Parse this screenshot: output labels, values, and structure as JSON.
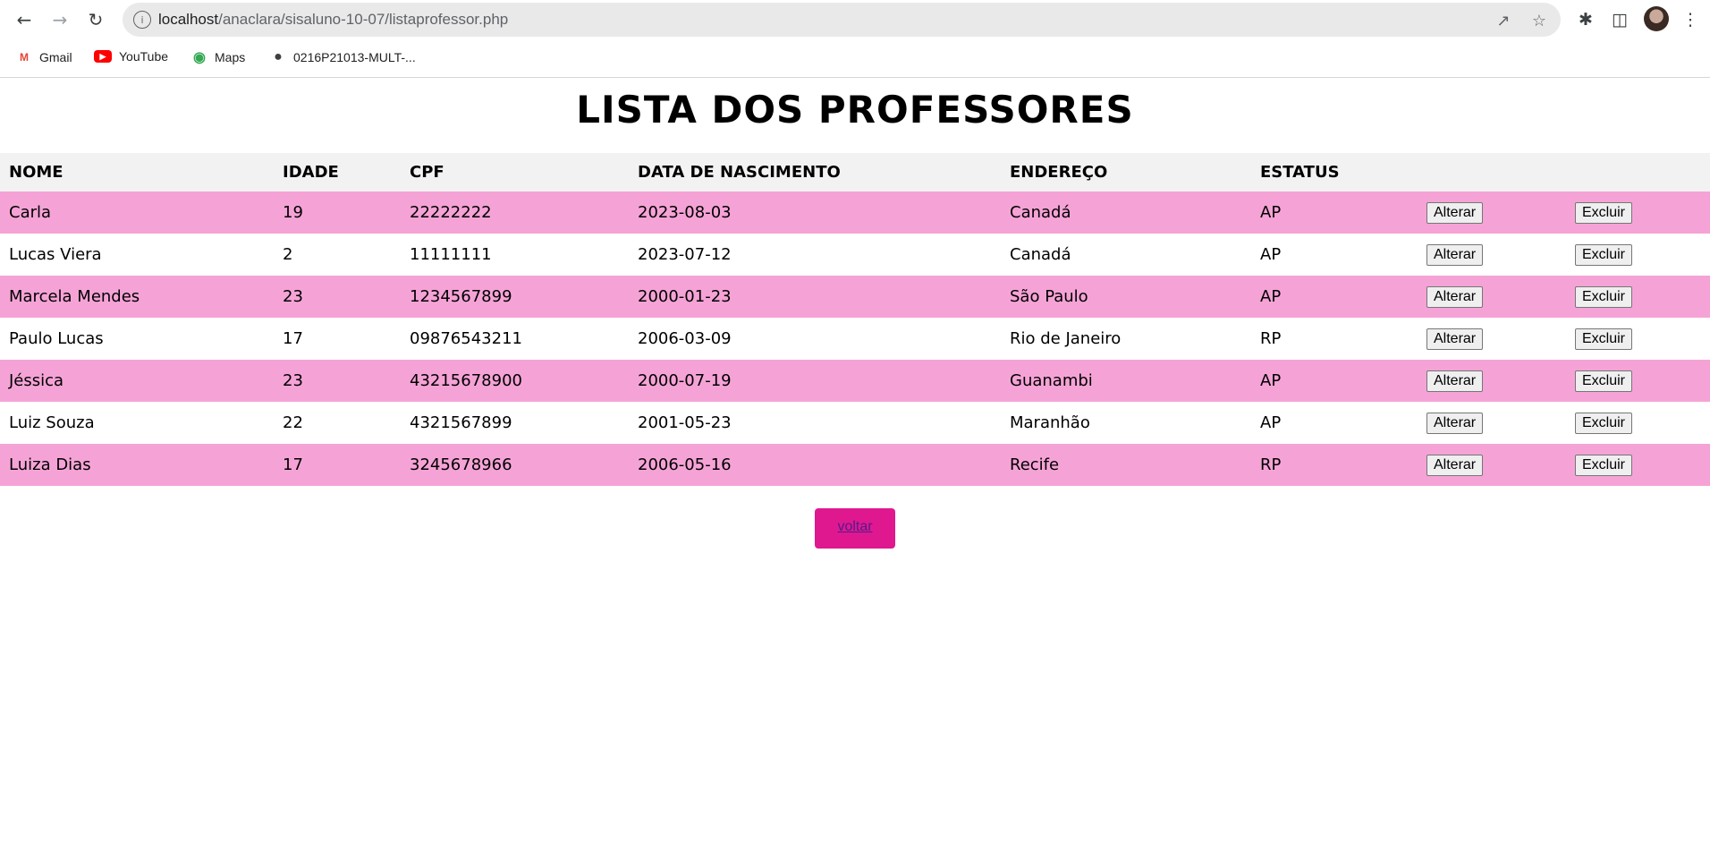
{
  "browser": {
    "url_host": "localhost",
    "url_path": "/anaclara/sisaluno-10-07/listaprofessor.php",
    "bookmarks": [
      {
        "label": "Gmail",
        "icon": "gmail-icon"
      },
      {
        "label": "YouTube",
        "icon": "youtube-icon"
      },
      {
        "label": "Maps",
        "icon": "maps-icon"
      },
      {
        "label": "0216P21013-MULT-...",
        "icon": "globe-icon"
      }
    ]
  },
  "page": {
    "title": "LISTA DOS PROFESSORES",
    "back_label": "voltar"
  },
  "table": {
    "headers": [
      "NOME",
      "IDADE",
      "CPF",
      "DATA DE NASCIMENTO",
      "ENDEREÇO",
      "ESTATUS"
    ],
    "edit_label": "Alterar",
    "delete_label": "Excluir",
    "rows": [
      {
        "nome": "Carla",
        "idade": "19",
        "cpf": "22222222",
        "nascimento": "2023-08-03",
        "endereco": "Canadá",
        "estatus": "AP"
      },
      {
        "nome": "Lucas Viera",
        "idade": "2",
        "cpf": "11111111",
        "nascimento": "2023-07-12",
        "endereco": "Canadá",
        "estatus": "AP"
      },
      {
        "nome": "Marcela Mendes",
        "idade": "23",
        "cpf": "1234567899",
        "nascimento": "2000-01-23",
        "endereco": "São Paulo",
        "estatus": "AP"
      },
      {
        "nome": "Paulo Lucas",
        "idade": "17",
        "cpf": "09876543211",
        "nascimento": "2006-03-09",
        "endereco": "Rio de Janeiro",
        "estatus": "RP"
      },
      {
        "nome": "Jéssica",
        "idade": "23",
        "cpf": "43215678900",
        "nascimento": "2000-07-19",
        "endereco": "Guanambi",
        "estatus": "AP"
      },
      {
        "nome": "Luiz Souza",
        "idade": "22",
        "cpf": "4321567899",
        "nascimento": "2001-05-23",
        "endereco": "Maranhão",
        "estatus": "AP"
      },
      {
        "nome": "Luiza Dias",
        "idade": "17",
        "cpf": "3245678966",
        "nascimento": "2006-05-16",
        "endereco": "Recife",
        "estatus": "RP"
      }
    ]
  },
  "colors": {
    "row_highlight": "#f5a3d6",
    "header_bg": "#f2f2f2",
    "back_button": "#e0188f"
  }
}
